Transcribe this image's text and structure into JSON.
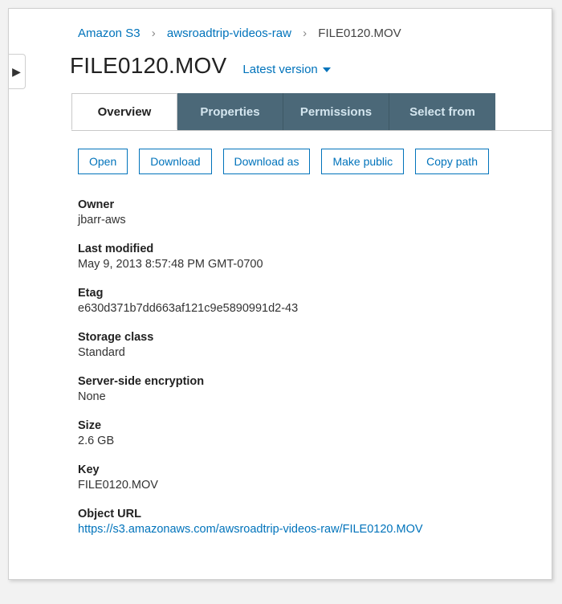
{
  "breadcrumbs": {
    "root": "Amazon S3",
    "bucket": "awsroadtrip-videos-raw",
    "object": "FILE0120.MOV"
  },
  "title": "FILE0120.MOV",
  "version_label": "Latest version",
  "tabs": {
    "overview": "Overview",
    "properties": "Properties",
    "permissions": "Permissions",
    "selectfrom": "Select from"
  },
  "actions": {
    "open": "Open",
    "download": "Download",
    "download_as": "Download as",
    "make_public": "Make public",
    "copy_path": "Copy path"
  },
  "props": {
    "owner_label": "Owner",
    "owner": "jbarr-aws",
    "lastmod_label": "Last modified",
    "lastmod": "May 9, 2013 8:57:48 PM GMT-0700",
    "etag_label": "Etag",
    "etag": "e630d371b7dd663af121c9e5890991d2-43",
    "storage_label": "Storage class",
    "storage": "Standard",
    "sse_label": "Server-side encryption",
    "sse": "None",
    "size_label": "Size",
    "size": "2.6 GB",
    "key_label": "Key",
    "key": "FILE0120.MOV",
    "url_label": "Object URL",
    "url": "https://s3.amazonaws.com/awsroadtrip-videos-raw/FILE0120.MOV"
  },
  "sideflap_glyph": "▶"
}
